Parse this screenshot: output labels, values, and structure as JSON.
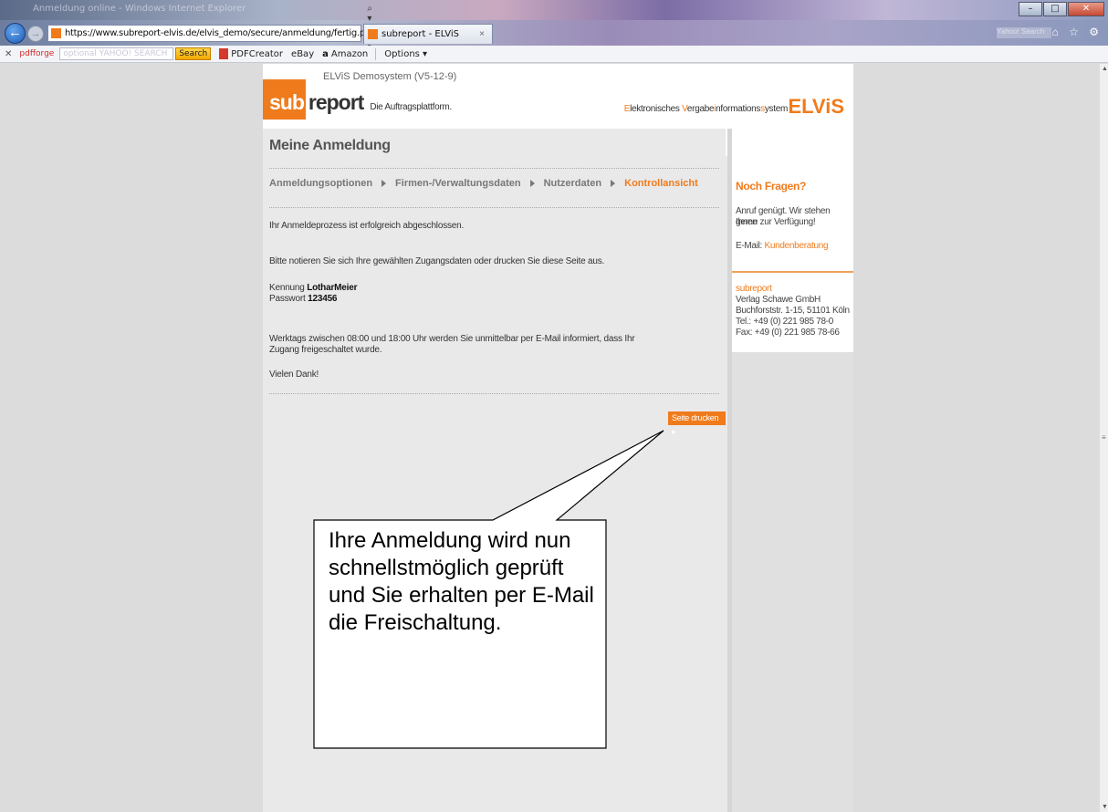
{
  "browser": {
    "window_title": "Anmeldung online - Windows Internet Explorer",
    "url": "https://www.subreport-elvis.de/elvis_demo/secure/anmeldung/fertig.pl",
    "address_tools": "⌕ ▾ 🔒 ⊠ ↻ ✕",
    "tab_title": "subreport - ELViS",
    "tab_close": "×",
    "search_hint": "Yahoo! Search",
    "right_icons": "⌂ ☆ ⚙"
  },
  "toolbar": {
    "close": "✕",
    "pdfforge": "pdfforge",
    "search_placeholder": "optional YAHOO! SEARCH",
    "search_label": "Search",
    "pdfcreator": "PDFCreator",
    "ebay": "eBay",
    "amazon_icon": "a",
    "amazon": "Amazon",
    "options": "Options ▾"
  },
  "page": {
    "version": "ELViS Demosystem (V5-12-9)",
    "logo_sub": "sub",
    "logo_report": "report",
    "logo_tagline": "Die Auftragsplattform.",
    "elvis_long": {
      "e": "E",
      "lektronisches": "lektronisches ",
      "v": "V",
      "ergabe": "ergabe",
      "i": "i",
      "nformations": "nformations",
      "s": "s",
      "ystem": "ystem"
    },
    "elvis_logo": "ELViS",
    "heading": "Meine Anmeldung",
    "steps": [
      "Anmeldungsoptionen",
      "Firmen-/Verwaltungsdaten",
      "Nutzerdaten",
      "Kontrollansicht"
    ],
    "msg_done": "Ihr Anmeldeprozess ist erfolgreich abgeschlossen.",
    "msg_note": "Bitte notieren Sie sich Ihre gewählten Zugangsdaten oder drucken Sie diese Seite aus.",
    "kennung_label": "Kennung",
    "kennung_value": "LotharMeier",
    "passwort_label": "Passwort",
    "passwort_value": "123456",
    "msg_weekday_1": "Werktags zwischen 08:00 und 18:00 Uhr werden Sie unmittelbar per E-Mail informiert, dass Ihr",
    "msg_weekday_2": "Zugang freigeschaltet wurde.",
    "thanks": "Vielen Dank!",
    "print_button": "Seite drucken ▸"
  },
  "sidebar": {
    "title": "Noch Fragen?",
    "text_1": "Anruf genügt. Wir stehen Ihnen",
    "text_2": "gerne zur Verfügung!",
    "email_label": "E-Mail:",
    "email_link": "Kundenberatung",
    "company_1": "subreport",
    "company_2": "Verlag Schawe GmbH",
    "company_3": "Buchforststr. 1-15, 51101 Köln",
    "company_4": "Tel.: +49 (0) 221 985 78-0",
    "company_5": "Fax: +49 (0) 221 985 78-66"
  },
  "callout": {
    "text": "Ihre Anmeldung wird nun schnellstmöglich geprüft und Sie erhalten per E-Mail die Freischaltung."
  },
  "colors": {
    "accent": "#f07b1c",
    "page_bg": "#e9e9e9",
    "body_bg": "#dcdcdc"
  }
}
